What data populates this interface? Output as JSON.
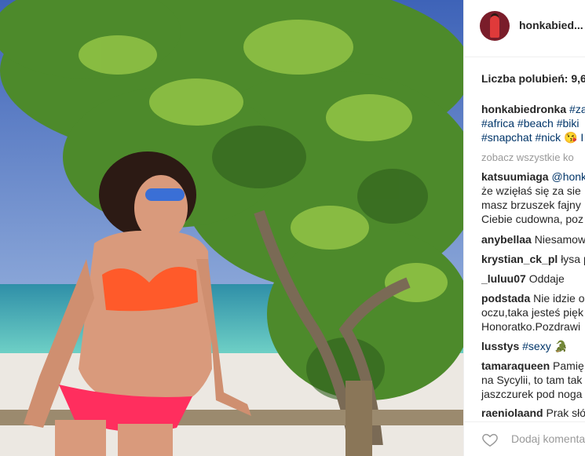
{
  "post": {
    "username": "honkabied...",
    "likes": "Liczba polubień: 9,6",
    "caption_user": "honkabiedronka",
    "caption_tag_1": "#za",
    "caption_line2": "#africa #beach #biki",
    "caption_line3": "#snapchat #nick 😘 I",
    "see_all": "zobacz wszystkie ko"
  },
  "comments": [
    {
      "user": "katsuumiaga",
      "text": "@honk"
    },
    {
      "user": "",
      "text": "że wzięłaś się za sie"
    },
    {
      "user": "",
      "text": "masz brzuszek fajny"
    },
    {
      "user": "",
      "text": "Ciebie cudowna, poz"
    },
    {
      "user": "anybellaa",
      "text": "Niesamow"
    },
    {
      "user": "krystian_ck_pl",
      "text": "łysa p"
    },
    {
      "user": "_luluu07",
      "text": "Oddaje"
    },
    {
      "user": "podstada",
      "text": "Nie idzie o"
    },
    {
      "user": "",
      "text": "oczu,taka jesteś pięk"
    },
    {
      "user": "",
      "text": "Honoratko.Pozdrawi"
    },
    {
      "user": "lusstys",
      "text": "#sexy 🐊"
    },
    {
      "user": "tamaraqueen",
      "text": "Pamię"
    },
    {
      "user": "",
      "text": "na Sycylii, to tam tak"
    },
    {
      "user": "",
      "text": "jaszczurek pod noga"
    },
    {
      "user": "raeniolaand",
      "text": "Prak słów"
    }
  ],
  "footer": {
    "add_comment": "Dodaj komenta",
    "heart_icon": "heart-outline-icon"
  },
  "colors": {
    "sky": "#5b7fc4",
    "sea": "#3fb0b0",
    "foliage": "#4f8a2a",
    "bikini_top": "#ff5a2a",
    "bikini_bottom": "#ff2e5e",
    "link": "#003569"
  }
}
